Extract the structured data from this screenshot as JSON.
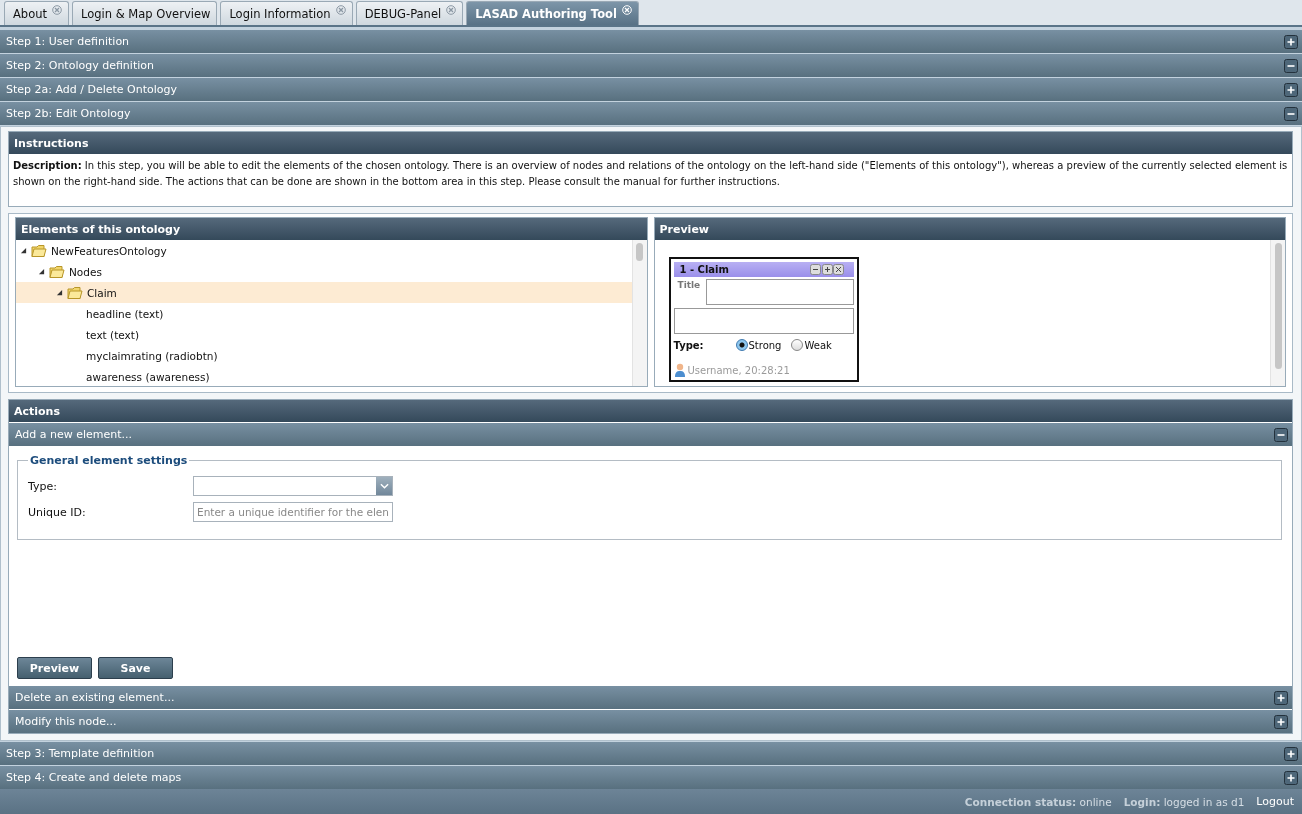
{
  "tabs": [
    {
      "label": "About",
      "closable": true,
      "selected": false
    },
    {
      "label": "Login & Map Overview",
      "closable": false,
      "selected": false
    },
    {
      "label": "Login Information",
      "closable": true,
      "selected": false
    },
    {
      "label": "DEBUG-Panel",
      "closable": true,
      "selected": false
    },
    {
      "label": "LASAD Authoring Tool",
      "closable": true,
      "selected": true
    }
  ],
  "steps": [
    {
      "title": "Step 1: User definition",
      "expanded": false
    },
    {
      "title": "Step 2: Ontology definition",
      "expanded": true
    },
    {
      "title": "Step 2a: Add / Delete Ontology",
      "expanded": false
    },
    {
      "title": "Step 2b: Edit Ontology",
      "expanded": true,
      "body": {
        "instructions": {
          "title": "Instructions",
          "text": "**Description:** In this step, you will be able to edit the elements of the chosen ontology. There is an overview of nodes and relations of the ontology on the left-hand side (\"Elements of this ontology\"), whereas a preview of the currently selected element is shown on the right-hand side. The actions that can be done are shown in the bottom area in this step. Please consult the manual for further instructions."
        },
        "elements": {
          "title": "Elements of this ontology",
          "tree": [
            {
              "label": "NewFeaturesOntology",
              "expanded": true,
              "selected": false,
              "children": [
                {
                  "label": "Nodes",
                  "expanded": true,
                  "selected": false,
                  "children": [
                    {
                      "label": "Claim",
                      "expanded": true,
                      "selected": true,
                      "children": [
                        {
                          "label": "headline (text)",
                          "selected": false
                        },
                        {
                          "label": "text (text)",
                          "selected": false
                        },
                        {
                          "label": "myclaimrating (radiobtn)",
                          "selected": false
                        },
                        {
                          "label": "awareness (awareness)",
                          "selected": false
                        }
                      ]
                    }
                  ]
                }
              ]
            }
          ]
        },
        "preview": {
          "title": "Preview",
          "node": {
            "title": "1 - Claim",
            "title_label": "Title",
            "type_label": "Type:",
            "options": [
              {
                "label": "Strong",
                "selected": true
              },
              {
                "label": "Weak",
                "selected": false
              }
            ],
            "footer": "Username, 20:28:21"
          }
        },
        "actions": {
          "title": "Actions",
          "sections": [
            {
              "title": "Add a new element...",
              "expanded": true,
              "form": {
                "legend": "General element settings",
                "type_label": "Type:",
                "id_label": "Unique ID:",
                "id_placeholder": "Enter a unique identifier for the elen",
                "buttons": [
                  "Preview",
                  "Save"
                ]
              }
            },
            {
              "title": "Delete an existing element...",
              "expanded": false
            },
            {
              "title": "Modify this node...",
              "expanded": false
            }
          ]
        }
      }
    },
    {
      "title": "Step 3: Template definition",
      "expanded": false
    },
    {
      "title": "Step 4: Create and delete maps",
      "expanded": false
    }
  ],
  "status_bar": {
    "connection": "**Connection status:** online",
    "login": "**Login:** logged in as d1",
    "logout": "Logout"
  }
}
